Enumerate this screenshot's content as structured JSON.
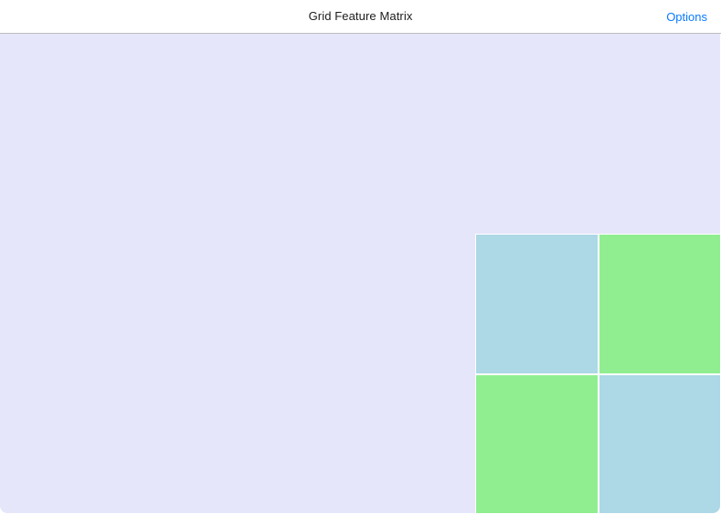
{
  "navbar": {
    "title": "Grid Feature Matrix",
    "action_label": "Options"
  },
  "colors": {
    "background": "#e6e6fa",
    "accent": "#0a7aff",
    "cell_blue": "#add8e6",
    "cell_green": "#90ee90"
  },
  "matrix": {
    "cells": [
      {
        "color": "#add8e6"
      },
      {
        "color": "#90ee90"
      },
      {
        "color": "#90ee90"
      },
      {
        "color": "#add8e6"
      }
    ]
  }
}
